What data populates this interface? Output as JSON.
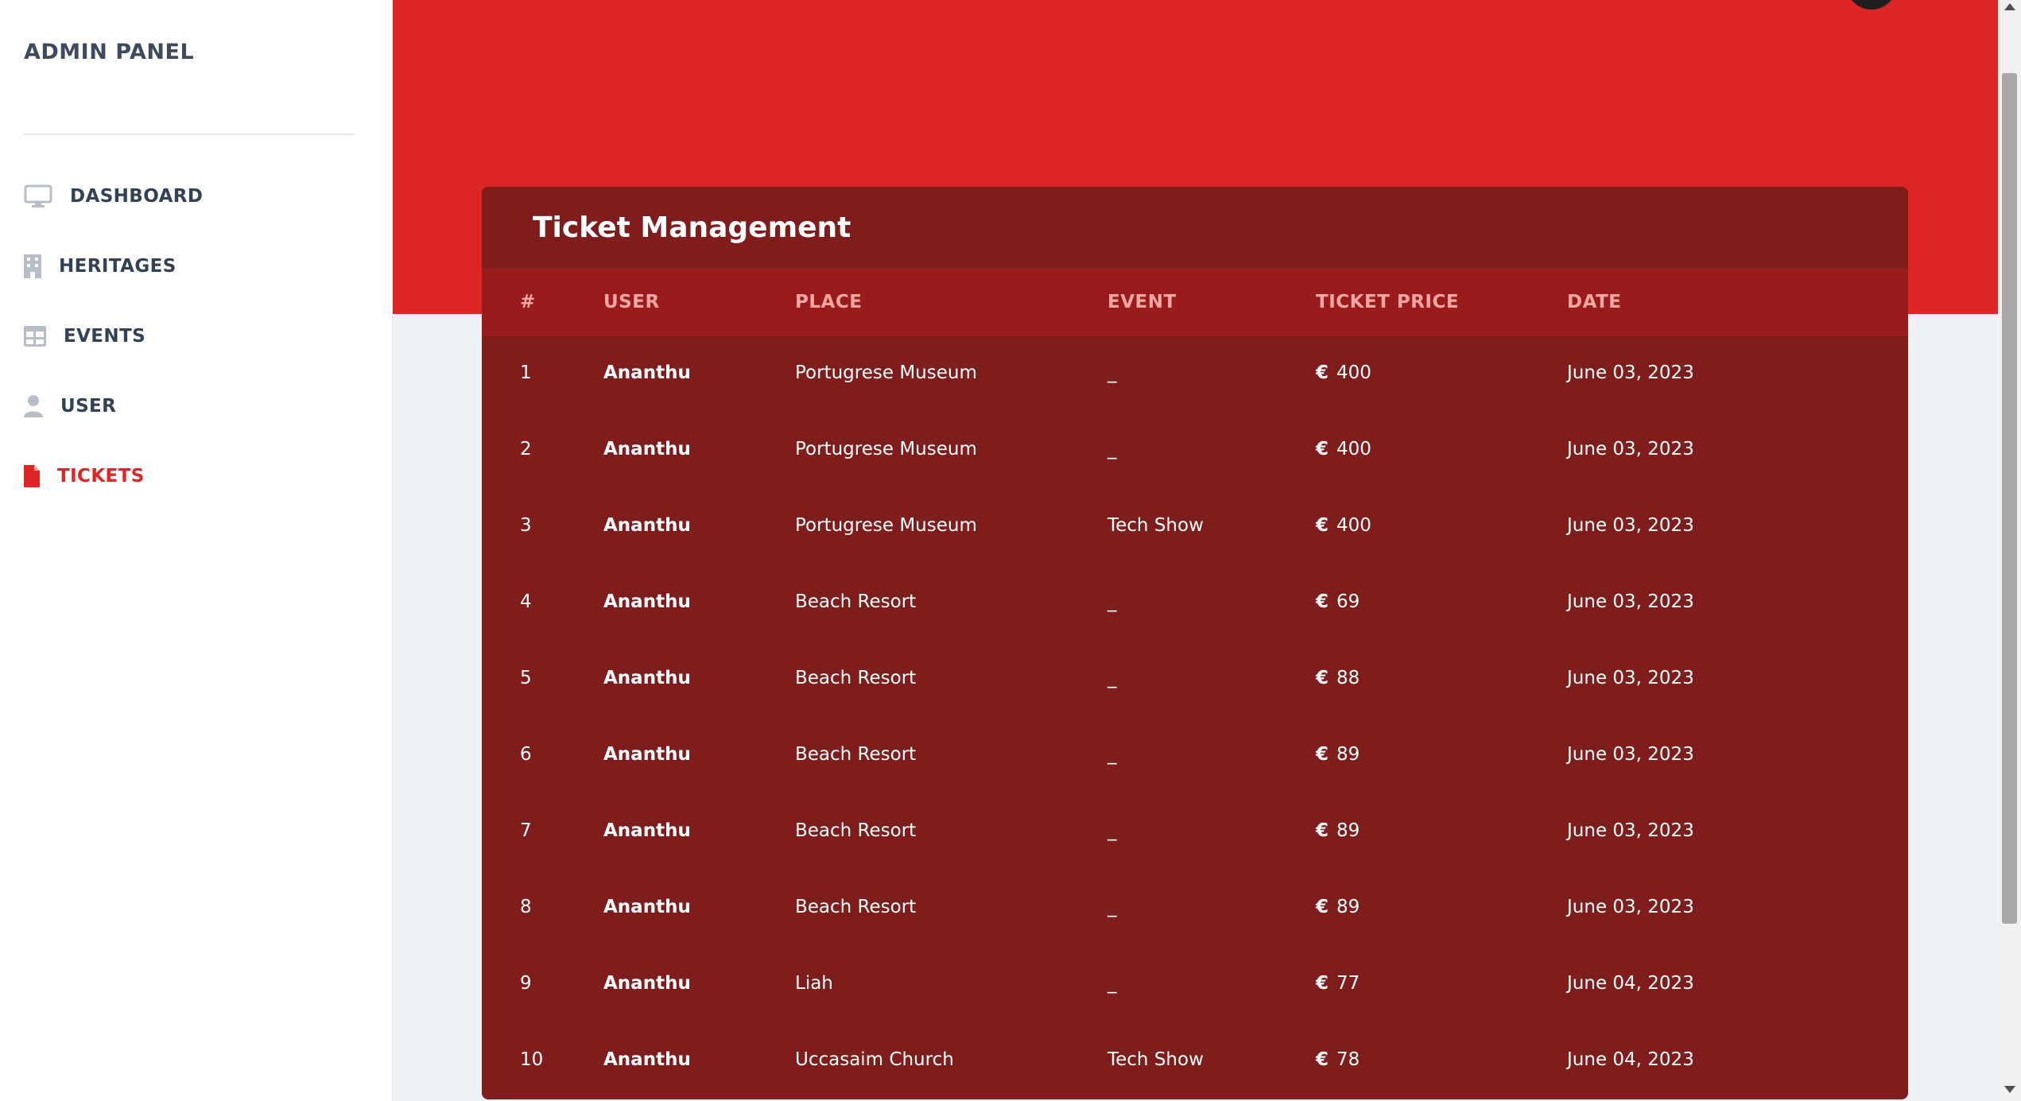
{
  "sidebar": {
    "brand": "ADMIN PANEL",
    "items": [
      {
        "label": "DASHBOARD",
        "icon": "monitor-icon",
        "active": false
      },
      {
        "label": "HERITAGES",
        "icon": "building-icon",
        "active": false
      },
      {
        "label": "EVENTS",
        "icon": "table-icon",
        "active": false
      },
      {
        "label": "USER",
        "icon": "user-icon",
        "active": false
      },
      {
        "label": "TICKETS",
        "icon": "file-icon",
        "active": true
      }
    ]
  },
  "card": {
    "title": "Ticket Management",
    "columns": [
      "#",
      "USER",
      "PLACE",
      "EVENT",
      "TICKET PRICE",
      "DATE"
    ],
    "currency": "€",
    "rows": [
      {
        "num": "1",
        "user": "Ananthu",
        "place": "Portugrese Museum",
        "event": "_",
        "price": "400",
        "date": "June 03, 2023"
      },
      {
        "num": "2",
        "user": "Ananthu",
        "place": "Portugrese Museum",
        "event": "_",
        "price": "400",
        "date": "June 03, 2023"
      },
      {
        "num": "3",
        "user": "Ananthu",
        "place": "Portugrese Museum",
        "event": "Tech Show",
        "price": "400",
        "date": "June 03, 2023"
      },
      {
        "num": "4",
        "user": "Ananthu",
        "place": "Beach Resort",
        "event": "_",
        "price": "69",
        "date": "June 03, 2023"
      },
      {
        "num": "5",
        "user": "Ananthu",
        "place": "Beach Resort",
        "event": "_",
        "price": "88",
        "date": "June 03, 2023"
      },
      {
        "num": "6",
        "user": "Ananthu",
        "place": "Beach Resort",
        "event": "_",
        "price": "89",
        "date": "June 03, 2023"
      },
      {
        "num": "7",
        "user": "Ananthu",
        "place": "Beach Resort",
        "event": "_",
        "price": "89",
        "date": "June 03, 2023"
      },
      {
        "num": "8",
        "user": "Ananthu",
        "place": "Beach Resort",
        "event": "_",
        "price": "89",
        "date": "June 03, 2023"
      },
      {
        "num": "9",
        "user": "Ananthu",
        "place": "Liah",
        "event": "_",
        "price": "77",
        "date": "June 04, 2023"
      },
      {
        "num": "10",
        "user": "Ananthu",
        "place": "Uccasaim Church",
        "event": "Tech Show",
        "price": "78",
        "date": "June 04, 2023"
      }
    ]
  },
  "colors": {
    "accent": "#dc2626",
    "card_bg": "#7f1d1d",
    "header_bg": "#991b1b",
    "header_text": "#fca5a5"
  }
}
